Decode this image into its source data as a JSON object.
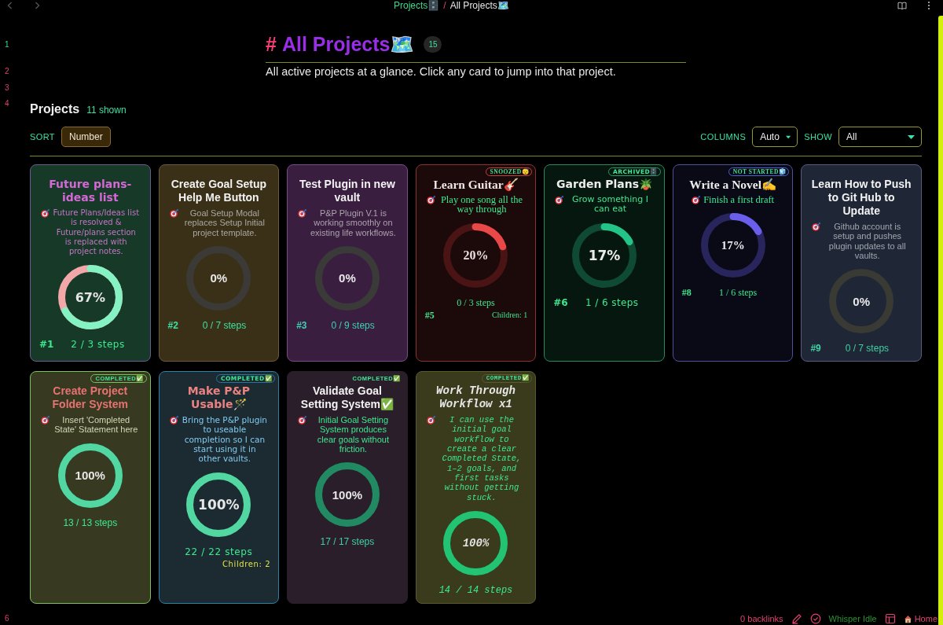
{
  "top_bar": {
    "breadcrumb": [
      {
        "label": "Projects🗄️",
        "selected": false
      },
      {
        "label": "All Projects🗺️",
        "selected": true
      }
    ],
    "separator": "/"
  },
  "line_numbers": [
    {
      "label": "1",
      "active": true
    },
    {
      "label": "2",
      "active": false
    },
    {
      "label": "3",
      "active": false
    },
    {
      "label": "4",
      "active": false
    },
    {
      "label": "6",
      "active": false
    }
  ],
  "heading": {
    "marker": "#",
    "title": "All Projects🗺️",
    "count": "15"
  },
  "description": "All active projects at a glance. Click any card to jump into that project.",
  "projects": {
    "title": "Projects",
    "shown": "11 shown",
    "sort_label": "SORT",
    "sort_button": "Number",
    "columns_label": "COLUMNS",
    "columns_value": "Auto",
    "show_label": "SHOW",
    "show_value": "All",
    "cards": [
      {
        "number": "#1",
        "title": "Future plans-ideas list",
        "goal": "Future Plans/Ideas list is resolved & Future/plans section is replaced with project notes.",
        "percent": "67%",
        "level": 0.67,
        "steps": "2 / 3 steps",
        "kind": "forest"
      },
      {
        "number": "#2",
        "title": "Create Goal Setup Help Me Button",
        "goal": "Goal Setup Modal replaces Setup Initial project template.",
        "percent": "0%",
        "level": 0,
        "steps": "0 / 7 steps",
        "kind": "ochre"
      },
      {
        "number": "#3",
        "title": "Test Plugin in new vault",
        "goal": "P&P Plugin V.1 is working smoothly on existing life workflows.",
        "percent": "0%",
        "level": 0,
        "steps": "0 / 9 steps",
        "kind": "plum"
      },
      {
        "badge": "SNOOZED😴",
        "number": "#5",
        "title": "Learn Guitar🎸",
        "goal": "Play one song all the way through",
        "percent": "20%",
        "level": 0.2,
        "steps": "0 / 3 steps",
        "subprojects": "Children: 1",
        "kind": "ember"
      },
      {
        "badge": "ARCHIVED🗄️",
        "number": "#6",
        "title": "Garden Plans🪴",
        "goal": "Grow something I can eat",
        "percent": "17%",
        "level": 0.17,
        "steps": "1 / 6 steps",
        "kind": "pine"
      },
      {
        "badge": "NOT STARTED🧊",
        "number": "#8",
        "title": "Write a Novel✍️",
        "goal": "Finish a first draft",
        "percent": "17%",
        "level": 0.17,
        "steps": "1 / 6 steps",
        "kind": "indigo"
      },
      {
        "number": "#9",
        "title": "Learn How to Push to Git Hub to Update",
        "goal": "Github account is setup and pushes plugin updates to all vaults.",
        "percent": "0%",
        "level": 0,
        "steps": "0 / 7 steps",
        "kind": "slate"
      },
      {
        "badge": "COMPLETED✅",
        "title": "Create Project Folder System",
        "goal": "Insert 'Completed State' Statement here",
        "percent": "100%",
        "level": 1,
        "steps": "13 / 13 steps",
        "kind": "moss"
      },
      {
        "badge": "COMPLETED✅",
        "title": "Make P&P Usable🪄",
        "goal": "Bring the P&P plugin to useable completion so I can start using it in other vaults.",
        "percent": "100%",
        "level": 1,
        "steps": "22 / 22 steps",
        "subprojects": "Children: 2",
        "kind": "lagoon"
      },
      {
        "badge": "COMPLETED✅",
        "title": "Validate Goal Setting System✅",
        "goal": "Initial Goal Setting System produces clear goals without friction.",
        "percent": "100%",
        "level": 1,
        "steps": "17 / 17 steps",
        "kind": "dusk"
      },
      {
        "badge": "COMPLETED✅",
        "title": "Work Through Workflow x1",
        "goal": "I can use the initial goal workflow to create a clear Completed State, 1–2 goals, and first tasks without getting stuck.",
        "percent": "100%",
        "level": 1,
        "steps": "14 / 14 steps",
        "kind": "olive"
      }
    ]
  },
  "status_bar": {
    "backlinks": "0 backlinks",
    "whisper": "Whisper Idle",
    "home": "Home"
  }
}
